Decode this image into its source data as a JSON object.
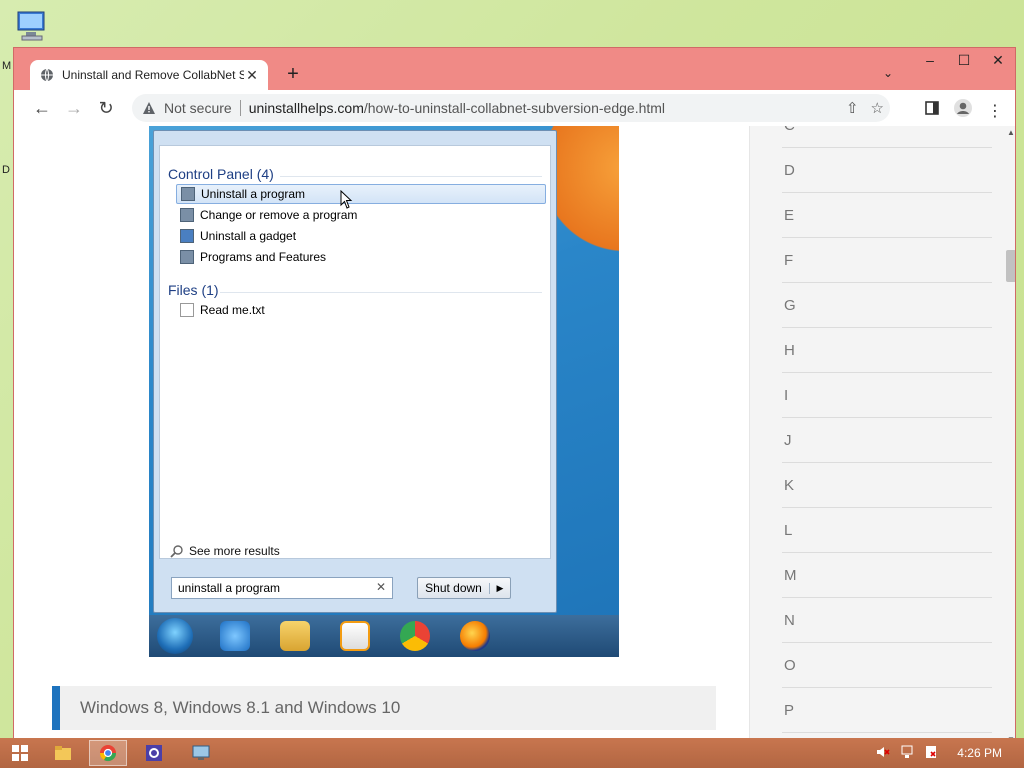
{
  "desktop": {
    "letters": [
      "M",
      "D"
    ]
  },
  "browser": {
    "tab_title": "Uninstall and Remove CollabNet Subversion Edge",
    "security_label": "Not secure",
    "url_domain": "uninstallhelps.com",
    "url_path": "/how-to-uninstall-collabnet-subversion-edge.html"
  },
  "start_menu": {
    "group_control_panel": "Control Panel (4)",
    "items": [
      "Uninstall a program",
      "Change or remove a program",
      "Uninstall a gadget",
      "Programs and Features"
    ],
    "group_files": "Files (1)",
    "file_items": [
      "Read me.txt"
    ],
    "see_more": "See more results",
    "search_value": "uninstall a program",
    "shutdown_label": "Shut down"
  },
  "section_heading": "Windows 8, Windows 8.1 and Windows 10",
  "sidebar": {
    "letters": [
      "C",
      "D",
      "E",
      "F",
      "G",
      "H",
      "I",
      "J",
      "K",
      "L",
      "M",
      "N",
      "O",
      "P"
    ]
  },
  "taskbar": {
    "clock": "4:26 PM"
  },
  "colors": {
    "window_frame": "#f08a86",
    "taskbar": "#b26642",
    "accent": "#1e73be"
  }
}
